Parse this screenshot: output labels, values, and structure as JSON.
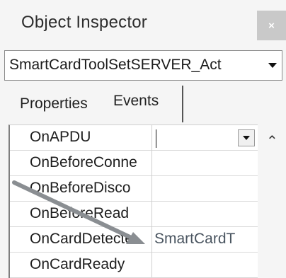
{
  "window": {
    "title": "Object Inspector",
    "close_glyph": "×"
  },
  "selector": {
    "value": "SmartCardToolSetSERVER_Act"
  },
  "tabs": [
    {
      "label": "Properties",
      "active": false
    },
    {
      "label": "Events",
      "active": true
    }
  ],
  "events": [
    {
      "name": "OnAPDU",
      "value": ""
    },
    {
      "name": "OnBeforeConne",
      "value": ""
    },
    {
      "name": "OnBeforeDisco",
      "value": ""
    },
    {
      "name": "OnBeforeRead",
      "value": ""
    },
    {
      "name": "OnCardDetecte",
      "value": "SmartCardT"
    },
    {
      "name": "OnCardReady",
      "value": ""
    }
  ],
  "icons": {
    "close": "close-icon",
    "combo_dropdown": "chevron-down-icon",
    "row_dropdown": "chevron-down-icon",
    "scroll_up": "chevron-up-icon",
    "annotation": "annotation-arrow"
  },
  "colors": {
    "background": "#f5f5f5",
    "close_button": "#c9c9c9",
    "arrow": "#8a8e92"
  }
}
